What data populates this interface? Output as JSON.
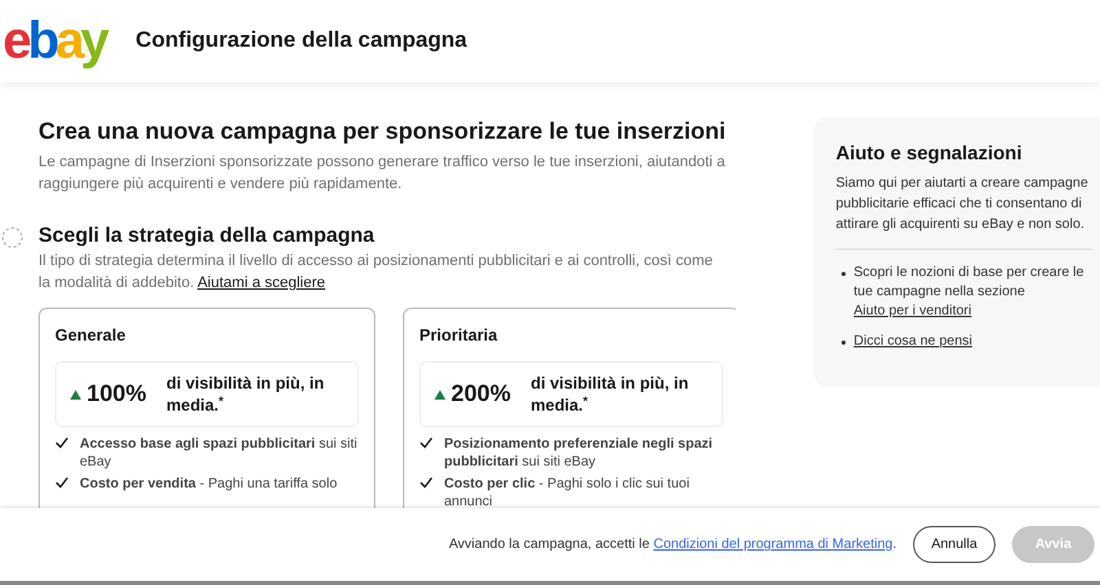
{
  "header": {
    "logo": [
      {
        "char": "e",
        "color": "#e53238"
      },
      {
        "char": "b",
        "color": "#0064d2"
      },
      {
        "char": "a",
        "color": "#f5af02"
      },
      {
        "char": "y",
        "color": "#86b817"
      }
    ],
    "title": "Configurazione della campagna"
  },
  "intro": {
    "title": "Crea una nuova campagna per sponsorizzare le tue inserzioni",
    "text": "Le campagne di Inserzioni sponsorizzate possono generare traffico verso le tue inserzioni, aiutandoti a raggiungere più acquirenti e vendere più rapidamente."
  },
  "strategy": {
    "title": "Scegli la strategia della campagna",
    "text": "Il tipo di strategia determina il livello di accesso ai posizionamenti pubblicitari e ai controlli, così come la modalità di addebito.",
    "link": "Aiutami a scegliere",
    "options": [
      {
        "name": "Generale",
        "value": "100%",
        "value_text": "di visibilità in più, in media.$^{*}$",
        "features": [
          "**Accesso base agli spazi pubblicitari** sui siti eBay",
          "**Costo per vendita** - Paghi una tariffa solo"
        ]
      },
      {
        "name": "Prioritaria",
        "value": "200%",
        "value_text": "di visibilità in più, in media.$^{*}$",
        "features": [
          "**Posizionamento preferenziale negli spazi pubblicitari** sui siti eBay",
          "**Costo per clic** - Paghi solo i clic sui tuoi annunci"
        ]
      }
    ]
  },
  "help": {
    "title": "Aiuto e segnalazioni",
    "text": "Siamo qui per aiutarti a creare campagne pubblicitarie efficaci che ti consentano di attirare gli acquirenti su eBay e non solo.",
    "items": [
      {
        "text": "Scopri le nozioni di base per creare le tue campagne nella sezione",
        "link": "Aiuto per i venditori"
      },
      {
        "link": "Dicci cosa ne pensi"
      }
    ]
  },
  "footer": {
    "text": "Avviando la campagna, accetti le",
    "link": "Condizioni del programma di Marketing",
    "after": ".",
    "buttons": [
      {
        "label": "Annulla",
        "disabled": false
      },
      {
        "label": "Avvia",
        "disabled": true
      }
    ]
  }
}
